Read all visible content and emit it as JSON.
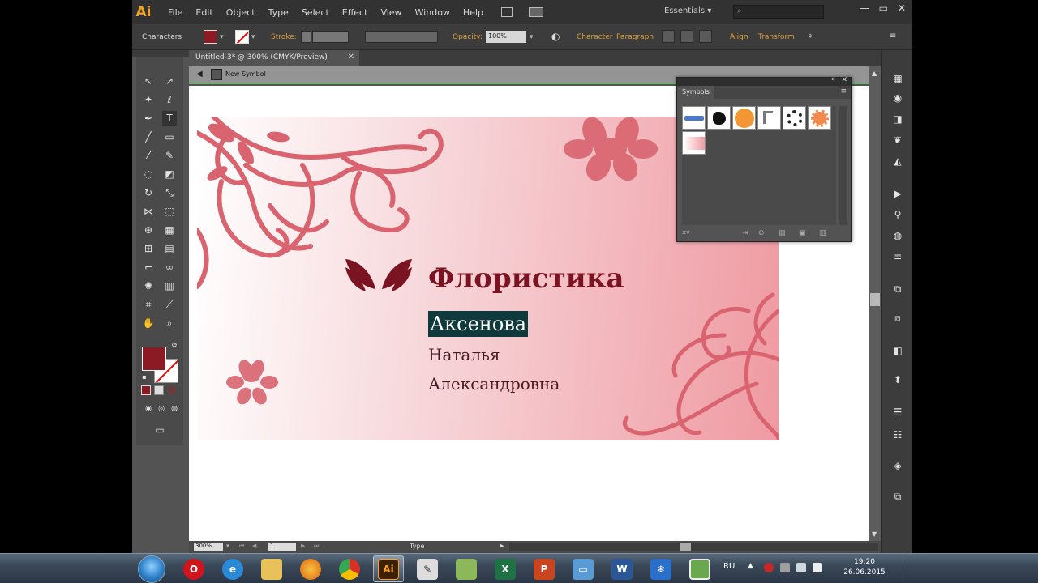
{
  "app": {
    "logo": "Ai",
    "menu": [
      "File",
      "Edit",
      "Object",
      "Type",
      "Select",
      "Effect",
      "View",
      "Window",
      "Help"
    ],
    "workspace": "Essentials",
    "window_controls": [
      "—",
      "▭",
      "✕"
    ]
  },
  "controlbar": {
    "panel_label": "Characters",
    "stroke_label": "Stroke:",
    "opacity_label": "Opacity:",
    "opacity_value": "100%",
    "character_link": "Character",
    "paragraph_link": "Paragraph",
    "align_link": "Align",
    "transform_link": "Transform",
    "fill_color": "#8c1a25"
  },
  "document": {
    "tab_title": "Untitled-3* @ 300% (CMYK/Preview)",
    "isolation_label": "New Symbol"
  },
  "artboard": {
    "title": "Флористика",
    "surname": "Аксенова",
    "first_name": "Наталья",
    "patronymic": "Александровна",
    "accent_color": "#7a1422",
    "flower_color": "#d9646f",
    "selection_color": "#0f3a3d"
  },
  "symbols_panel": {
    "tab_label": "Symbols",
    "items": [
      "blue-banner",
      "black-splash",
      "orange-circle",
      "bracket-shape",
      "gear-ring",
      "orange-flower",
      "floral-card"
    ]
  },
  "statusbar": {
    "zoom": "300%",
    "page": "1",
    "status_text": "Type"
  },
  "taskbar": {
    "apps": [
      "start-orb",
      "opera",
      "internet-explorer",
      "file-explorer",
      "firefox",
      "chrome",
      "illustrator",
      "clipboard",
      "paint",
      "excel",
      "powerpoint",
      "remote-desktop",
      "word",
      "snowflake-app",
      "image-viewer"
    ],
    "language": "RU",
    "time": "19:20",
    "date": "26.06.2015"
  }
}
